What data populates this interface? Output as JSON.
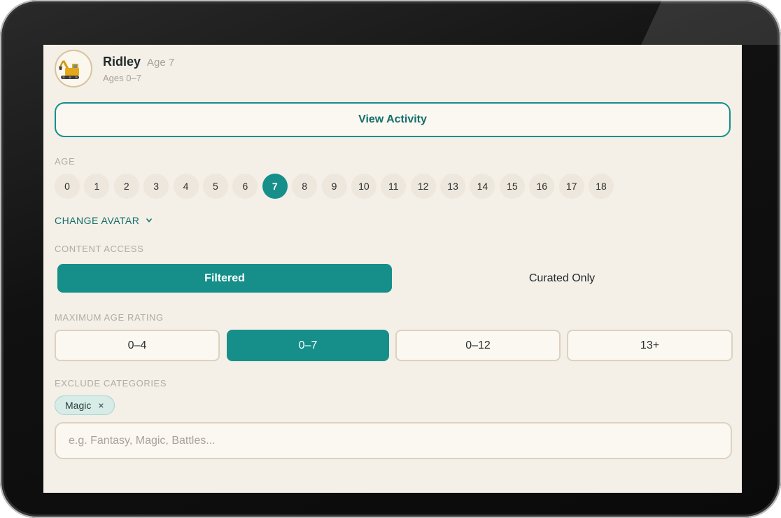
{
  "profile": {
    "name": "Ridley",
    "age_label": "Age 7",
    "range_label": "Ages 0–7",
    "avatar_icon": "excavator-icon"
  },
  "view_activity_label": "View Activity",
  "age": {
    "label": "AGE",
    "options": [
      "0",
      "1",
      "2",
      "3",
      "4",
      "5",
      "6",
      "7",
      "8",
      "9",
      "10",
      "11",
      "12",
      "13",
      "14",
      "15",
      "16",
      "17",
      "18"
    ],
    "selected": "7"
  },
  "change_avatar_label": "CHANGE AVATAR",
  "content_access": {
    "label": "CONTENT ACCESS",
    "options": [
      "Filtered",
      "Curated Only"
    ],
    "selected": "Filtered"
  },
  "max_age_rating": {
    "label": "MAXIMUM AGE RATING",
    "options": [
      "0–4",
      "0–7",
      "0–12",
      "13+"
    ],
    "selected": "0–7"
  },
  "exclude_categories": {
    "label": "EXCLUDE CATEGORIES",
    "chips": [
      "Magic"
    ],
    "chip_remove_glyph": "×",
    "input_value": "",
    "placeholder": "e.g. Fantasy, Magic, Battles..."
  },
  "colors": {
    "accent": "#168f8a",
    "accent_text": "#136f6b",
    "background": "#f4efe7",
    "chip_bg": "#d7ece7"
  }
}
